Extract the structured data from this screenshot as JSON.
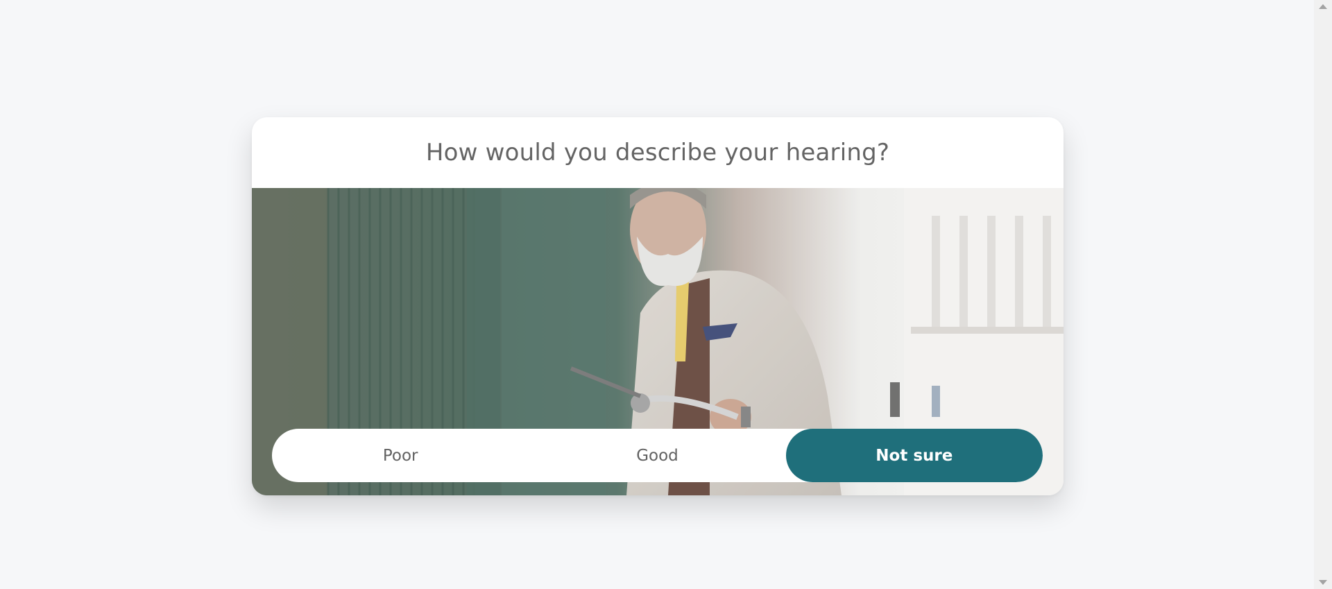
{
  "question": {
    "title": "How would you describe your hearing?"
  },
  "photo": {
    "subject": "older-man-with-bicycle-photo"
  },
  "options": [
    {
      "label": "Poor",
      "selected": false
    },
    {
      "label": "Good",
      "selected": false
    },
    {
      "label": "Not sure",
      "selected": true
    }
  ],
  "colors": {
    "accent": "#1f6f7b",
    "page_background": "#f6f7f9",
    "card_background": "#ffffff",
    "text": "#646464"
  },
  "icons": {
    "scroll_up": "scroll-up-arrow-icon",
    "scroll_down": "scroll-down-arrow-icon"
  }
}
